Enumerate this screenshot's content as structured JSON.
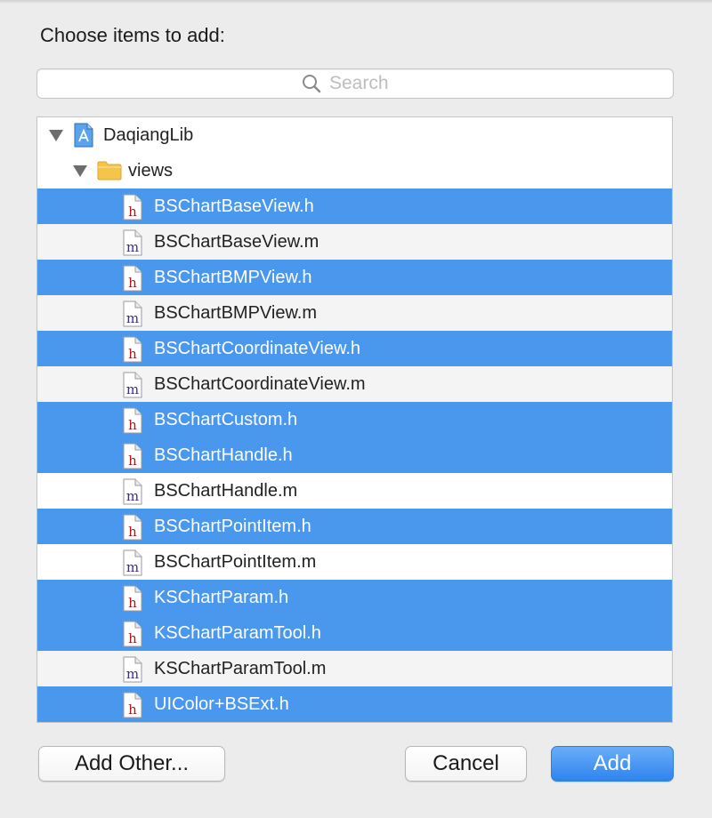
{
  "dialog": {
    "heading": "Choose items to add:",
    "search": {
      "placeholder": "Search",
      "value": ""
    }
  },
  "tree": {
    "project": {
      "name": "DaqiangLib",
      "icon": "xcode-project-icon",
      "expanded": true
    },
    "group": {
      "name": "views",
      "icon": "folder-icon",
      "expanded": true
    },
    "files": [
      {
        "name": "BSChartBaseView.h",
        "type": "h",
        "selected": true
      },
      {
        "name": "BSChartBaseView.m",
        "type": "m",
        "selected": false
      },
      {
        "name": "BSChartBMPView.h",
        "type": "h",
        "selected": true
      },
      {
        "name": "BSChartBMPView.m",
        "type": "m",
        "selected": false
      },
      {
        "name": "BSChartCoordinateView.h",
        "type": "h",
        "selected": true
      },
      {
        "name": "BSChartCoordinateView.m",
        "type": "m",
        "selected": false
      },
      {
        "name": "BSChartCustom.h",
        "type": "h",
        "selected": true
      },
      {
        "name": "BSChartHandle.h",
        "type": "h",
        "selected": true
      },
      {
        "name": "BSChartHandle.m",
        "type": "m",
        "selected": false
      },
      {
        "name": "BSChartPointItem.h",
        "type": "h",
        "selected": true
      },
      {
        "name": "BSChartPointItem.m",
        "type": "m",
        "selected": false
      },
      {
        "name": "KSChartParam.h",
        "type": "h",
        "selected": true
      },
      {
        "name": "KSChartParamTool.h",
        "type": "h",
        "selected": true
      },
      {
        "name": "KSChartParamTool.m",
        "type": "m",
        "selected": false
      },
      {
        "name": "UIColor+BSExt.h",
        "type": "h",
        "selected": true
      }
    ]
  },
  "buttons": {
    "add_other": "Add Other...",
    "cancel": "Cancel",
    "add": "Add"
  },
  "colors": {
    "selection": "#4a97ee",
    "header_glyph": "#a01818",
    "impl_glyph": "#3b2f87",
    "primary_button": "#2f84ee"
  }
}
